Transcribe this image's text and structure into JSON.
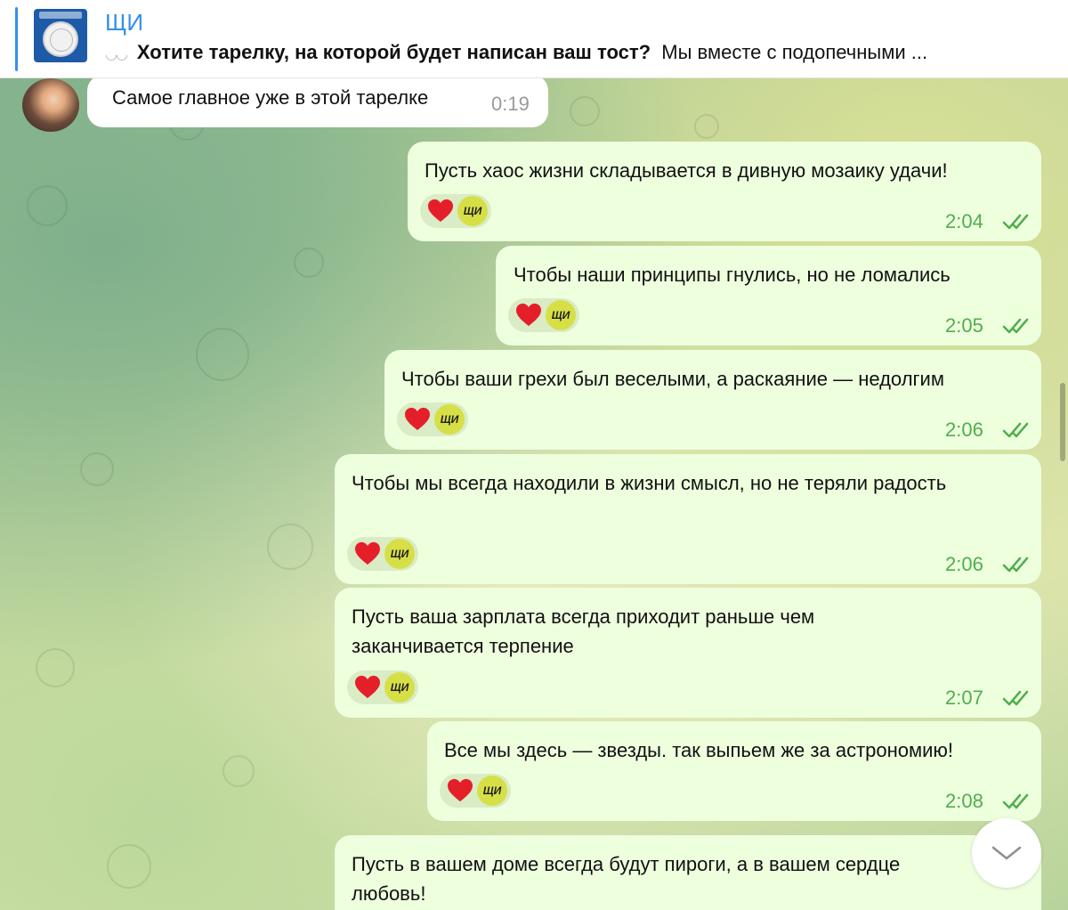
{
  "pinned": {
    "title": "ЩИ",
    "lead": "Хотите тарелку, на которой будет написан ваш тост?",
    "rest": "Мы вместе с подопечными ..."
  },
  "incoming": {
    "text": "Самое главное уже в этой тарелке",
    "time": "0:19"
  },
  "reaction": {
    "emoji": "heart",
    "avatar_label": "ЩИ"
  },
  "messages": [
    {
      "text": "Пусть хаос жизни складывается в дивную мозаику удачи!",
      "time": "2:04"
    },
    {
      "text": "Чтобы наши принципы гнулись, но не ломались",
      "time": "2:05"
    },
    {
      "text": "Чтобы ваши грехи был веселыми, а раскаяние — недолгим",
      "time": "2:06"
    },
    {
      "text": "Чтобы мы всегда находили в жизни смысл, но не теряли радость",
      "time": "2:06"
    },
    {
      "text": "Пусть ваша зарплата всегда приходит раньше чем заканчивается терпение",
      "time": "2:07"
    },
    {
      "text": "Все мы здесь — звезды. так выпьем же за астрономию!",
      "time": "2:08"
    },
    {
      "text": "Пусть в вашем доме всегда будут пироги, а в вашем сердце любовь!",
      "time": ""
    }
  ],
  "colors": {
    "accent": "#3390ec",
    "outgoing_bubble": "#eeffde",
    "time_green": "#4fae4e",
    "reaction_avatar": "#d7df47"
  }
}
